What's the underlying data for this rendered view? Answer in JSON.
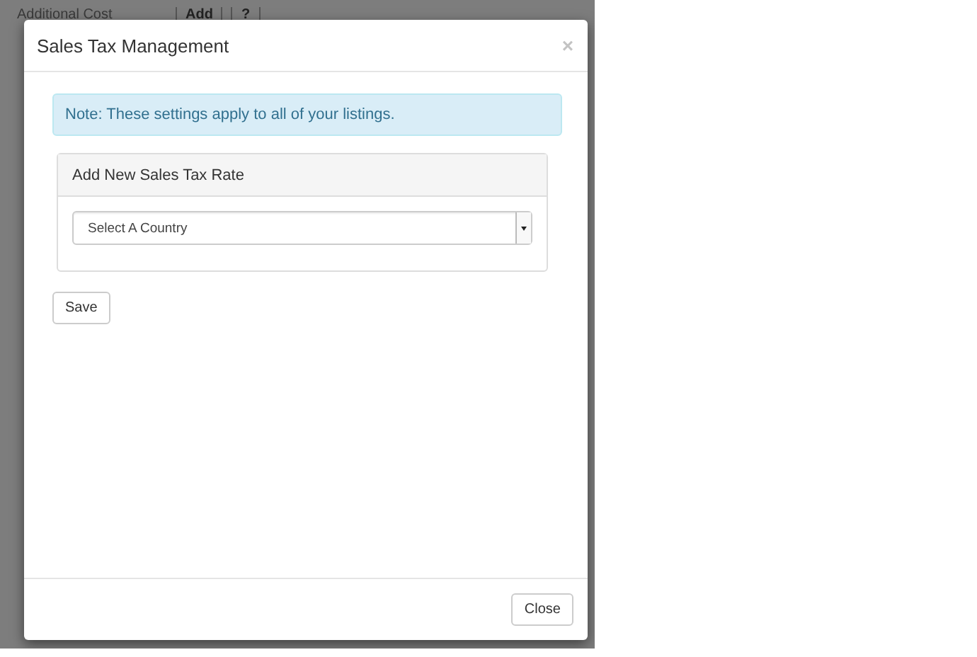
{
  "background_page": {
    "label": "Additional Cost",
    "add_button": "Add",
    "help_button": "?"
  },
  "modal": {
    "title": "Sales Tax Management",
    "close_icon": "×",
    "note": "Note: These settings apply to all of your listings.",
    "panel": {
      "heading": "Add New Sales Tax Rate",
      "select": {
        "value": "Select A Country"
      }
    },
    "save_button": "Save",
    "footer_button": "Close"
  }
}
